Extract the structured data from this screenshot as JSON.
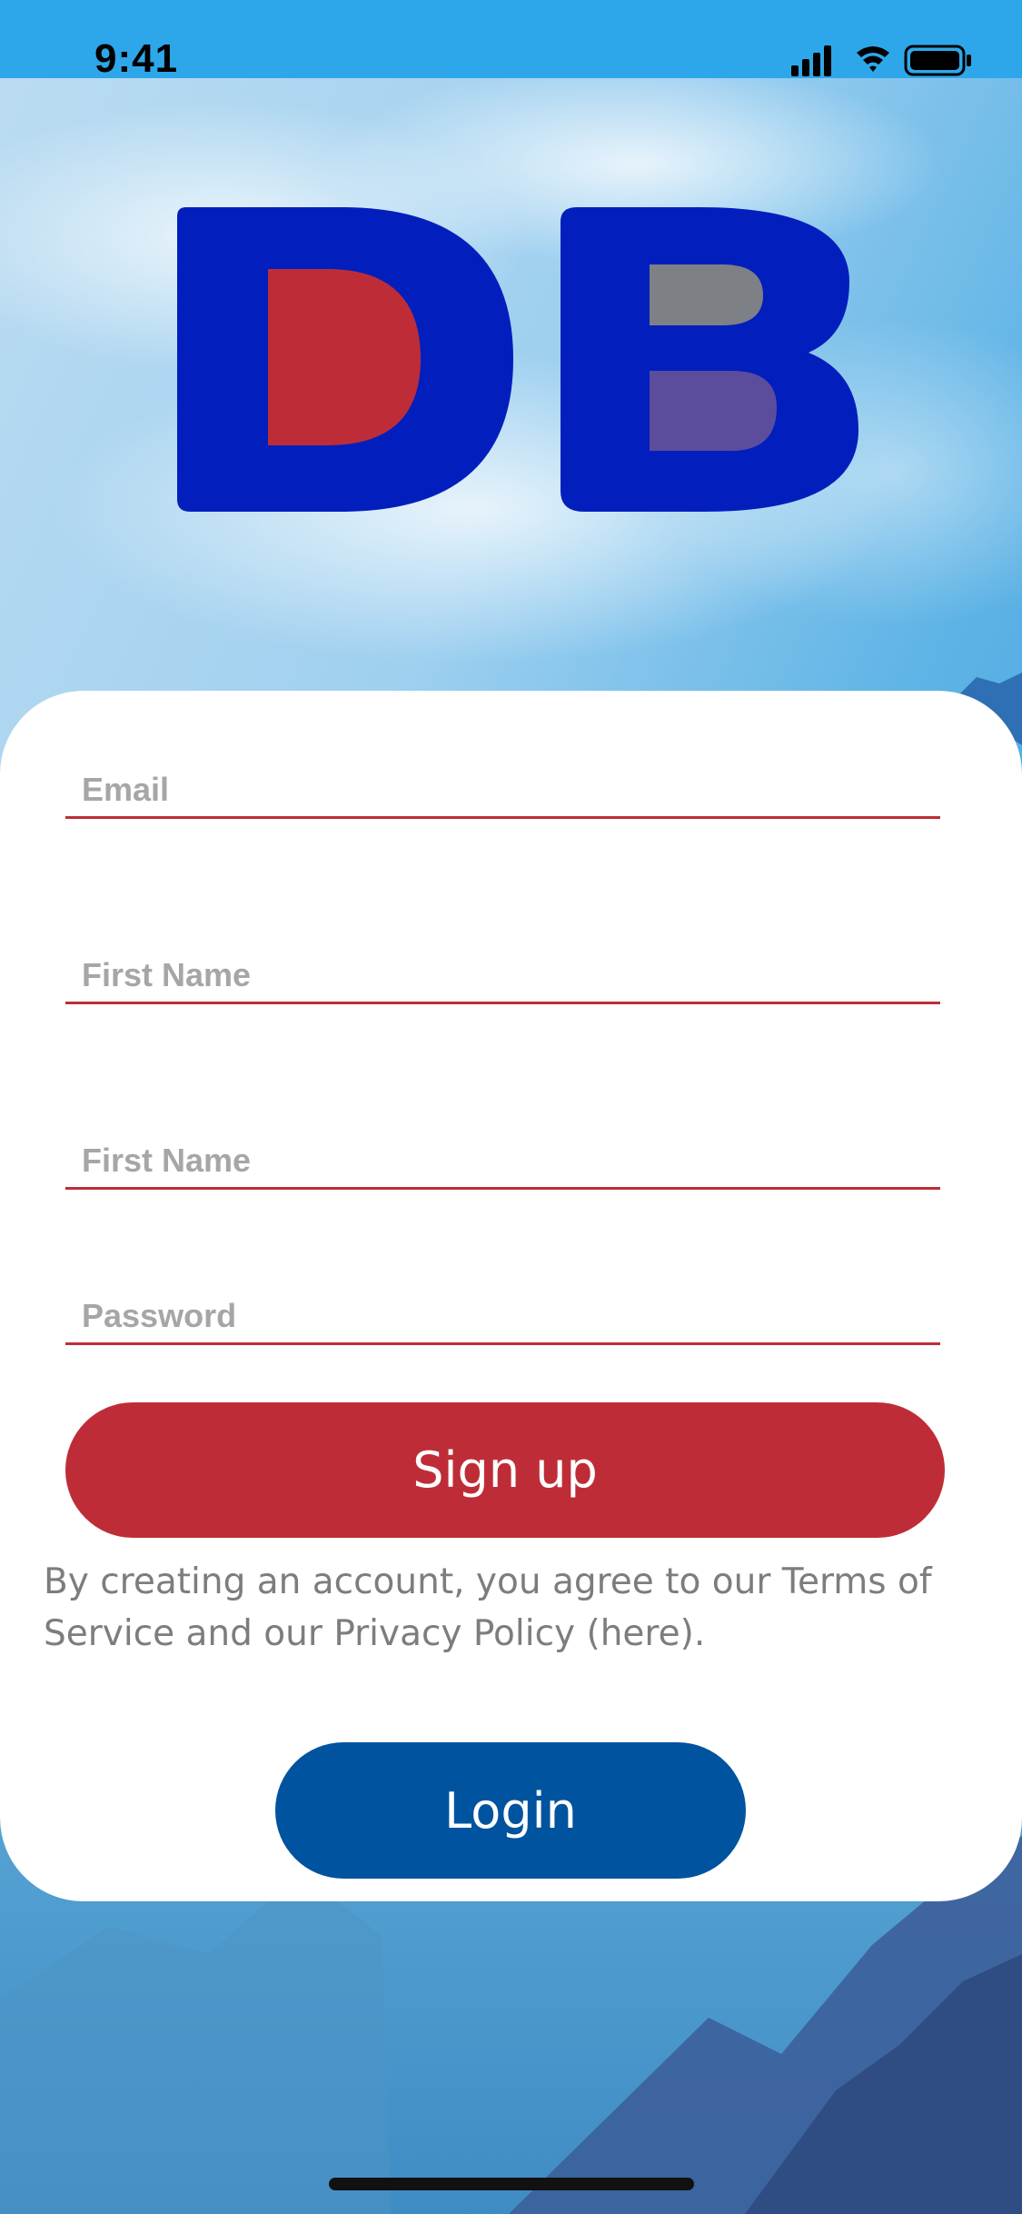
{
  "status_bar": {
    "time": "9:41"
  },
  "logo": {
    "alt": "DB"
  },
  "form": {
    "email_placeholder": "Email",
    "first_name_placeholder": "First Name",
    "last_name_placeholder": "First Name",
    "password_placeholder": "Password",
    "email_value": "",
    "first_name_value": "",
    "last_name_value": "",
    "password_value": ""
  },
  "actions": {
    "signup_label": "Sign up",
    "terms_prefix": "By creating an account, you agree to our Terms of Service and our Privacy Policy ",
    "terms_link": "(here)",
    "terms_suffix": ".",
    "login_label": "Login"
  },
  "colors": {
    "accent_red": "#be2d37",
    "login_blue": "#00539e",
    "logo_blue": "#021fbd",
    "status_bar_blue": "#2ea7ea"
  }
}
